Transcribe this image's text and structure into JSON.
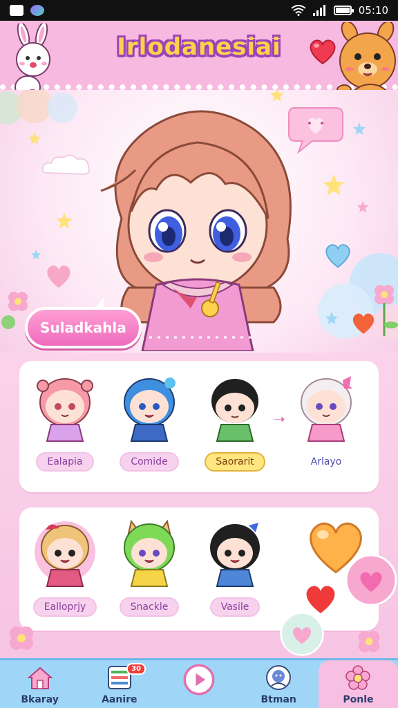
{
  "status_bar": {
    "time": "05:10"
  },
  "header": {
    "title": "Irlodanesiai"
  },
  "hero": {
    "name_tag": "Suladkahla",
    "speech_bubble_text": "..."
  },
  "roster_1": [
    {
      "name": "Ealapia",
      "hair": "#f79aa8",
      "outfit": "#d9a2ea",
      "selected": false
    },
    {
      "name": "Comide",
      "hair": "#3f8fe0",
      "outfit": "#3c6ac5",
      "selected": false
    },
    {
      "name": "Saorarit",
      "hair": "#202020",
      "outfit": "#6abf6a",
      "selected": true
    },
    {
      "name": "Arlayo",
      "hair": "#f3eef0",
      "outfit": "#f59ac9",
      "selected": false
    }
  ],
  "roster_2": [
    {
      "name": "Ealloprjy",
      "hair": "#f0c37a",
      "outfit": "#e35b83",
      "selected": false
    },
    {
      "name": "Snackle",
      "hair": "#7ed957",
      "outfit": "#f5d448",
      "selected": false
    },
    {
      "name": "Vasile",
      "hair": "#202020",
      "outfit": "#4f87d8",
      "selected": false
    }
  ],
  "nav": [
    {
      "label": "Bkaray",
      "icon": "home-icon",
      "badge": ""
    },
    {
      "label": "Aanire",
      "icon": "list-icon",
      "badge": "30"
    },
    {
      "label": "",
      "icon": "play-icon",
      "badge": ""
    },
    {
      "label": "Btman",
      "icon": "face-icon",
      "badge": ""
    },
    {
      "label": "Ponle",
      "icon": "flower-icon",
      "badge": ""
    }
  ],
  "colors": {
    "accent": "#ee6cbd",
    "title_outline": "#9b43b8",
    "nav_bg": "#9fd6f8"
  }
}
